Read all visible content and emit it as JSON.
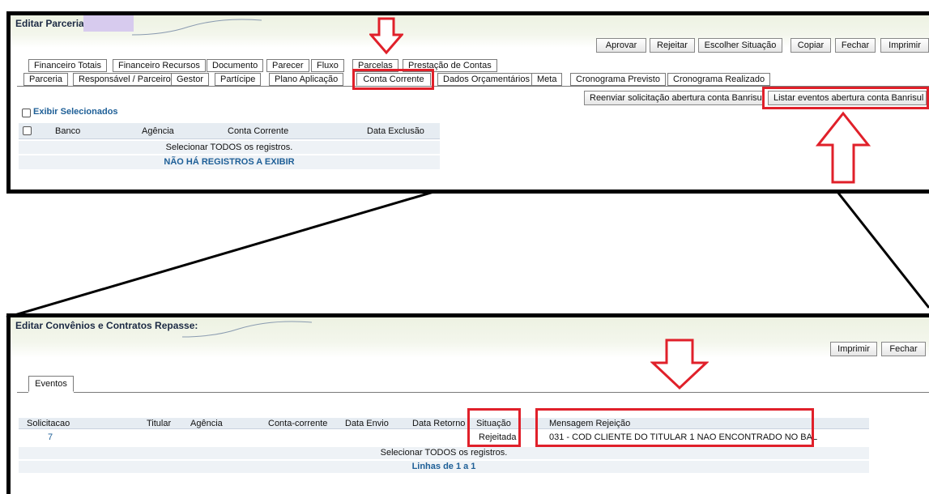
{
  "top": {
    "title": "Editar Parceria:",
    "actions": [
      "Aprovar",
      "Rejeitar",
      "Escolher Situação",
      "Copiar",
      "Fechar",
      "Imprimir"
    ],
    "tabs_row1": [
      "Financeiro Totais",
      "Financeiro Recursos",
      "Documento",
      "Parecer",
      "Fluxo",
      "Parcelas",
      "Prestação de Contas"
    ],
    "tabs_row2": [
      "Parceria",
      "Responsável / Parceiro",
      "Gestor",
      "Partícipe",
      "Plano Aplicação",
      "Conta Corrente",
      "Dados Orçamentários",
      "Meta",
      "Cronograma Previsto",
      "Cronograma Realizado"
    ],
    "sub_actions": [
      "Reenviar solicitação abertura conta Banrisul",
      "Listar eventos abertura conta Banrisul"
    ],
    "show_selected": "Exibir Selecionados",
    "columns": [
      "Banco",
      "Agência",
      "Conta Corrente",
      "Data Exclusão"
    ],
    "select_all": "Selecionar TODOS os registros.",
    "empty": "NÃO HÁ REGISTROS A EXIBIR"
  },
  "bottom": {
    "title": "Editar Convênios e Contratos Repasse:",
    "actions": [
      "Imprimir",
      "Fechar"
    ],
    "tab": "Eventos",
    "columns": [
      "Solicitacao",
      "Titular",
      "Agência",
      "Conta-corrente",
      "Data Envio",
      "Data Retorno",
      "Situação",
      "Mensagem Rejeição"
    ],
    "row": {
      "solicitacao": "7",
      "situacao": "Rejeitada",
      "mensagem": "031 - COD CLIENTE DO TITULAR 1 NAO ENCONTRADO NO BAL"
    },
    "select_all": "Selecionar TODOS os registros.",
    "lines": "Linhas de 1 a 1"
  },
  "colors": {
    "highlight": "#e0202a",
    "link": "#1e5f97",
    "header_band": "#edf2e2",
    "grid": "#eef2f6"
  },
  "icons": [
    "down-arrow-icon",
    "up-arrow-icon",
    "checkbox-icon"
  ]
}
